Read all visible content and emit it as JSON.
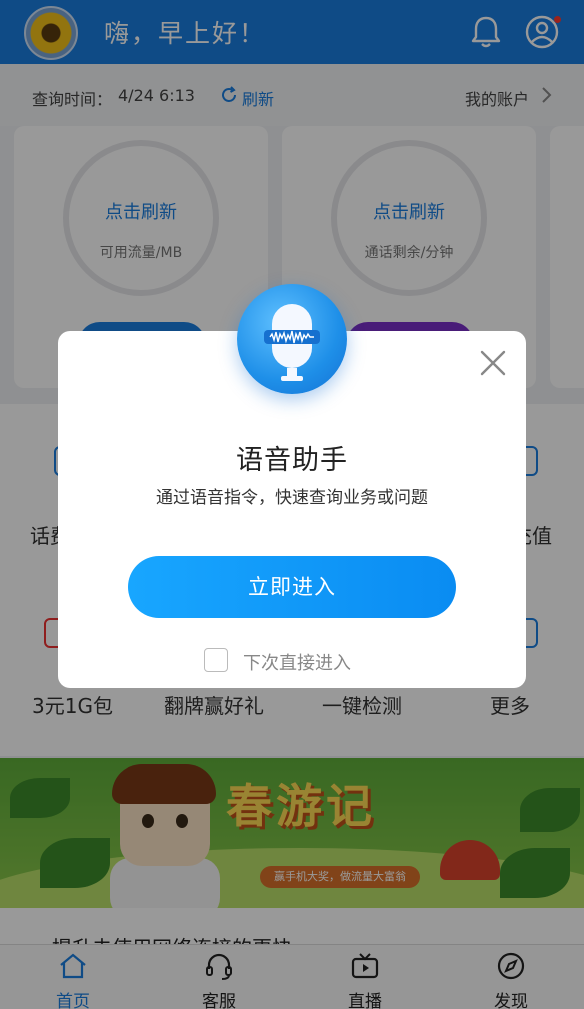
{
  "header": {
    "greeting": "嗨，早上好！",
    "icons": [
      "avatar",
      "bell-icon",
      "user-icon"
    ]
  },
  "query": {
    "label": "查询时间：",
    "time": "4/24 6:13",
    "refresh_label": "刷新",
    "account_label": "我的账户"
  },
  "cards": [
    {
      "title": "点击刷新",
      "subtitle": "可用流量/MB"
    },
    {
      "title": "点击刷新",
      "subtitle": "通话剩余/分钟"
    }
  ],
  "services_row1": {
    "left_partial": "话费",
    "right_partial": "充值"
  },
  "services_row2": [
    {
      "label": "3元1G包"
    },
    {
      "label": "翻牌赢好礼"
    },
    {
      "label": "一键检测"
    },
    {
      "label": "更多"
    }
  ],
  "banner": {
    "title": "春游记",
    "subtitle": "赢手机大奖，做流量大富翁"
  },
  "news": {
    "text": "提升未使用网络连接的更快"
  },
  "tabbar": {
    "items": [
      {
        "label": "首页",
        "icon": "home-icon",
        "active": true
      },
      {
        "label": "客服",
        "icon": "headset-icon",
        "active": false
      },
      {
        "label": "直播",
        "icon": "tv-icon",
        "active": false
      },
      {
        "label": "发现",
        "icon": "compass-icon",
        "active": false
      }
    ]
  },
  "dialog": {
    "title": "语音助手",
    "subtitle": "通过语音指令，快速查询业务或问题",
    "enter_label": "立即进入",
    "checkbox_label": "下次直接进入",
    "checkbox_checked": false,
    "accent_color": "#0a8cf2"
  }
}
